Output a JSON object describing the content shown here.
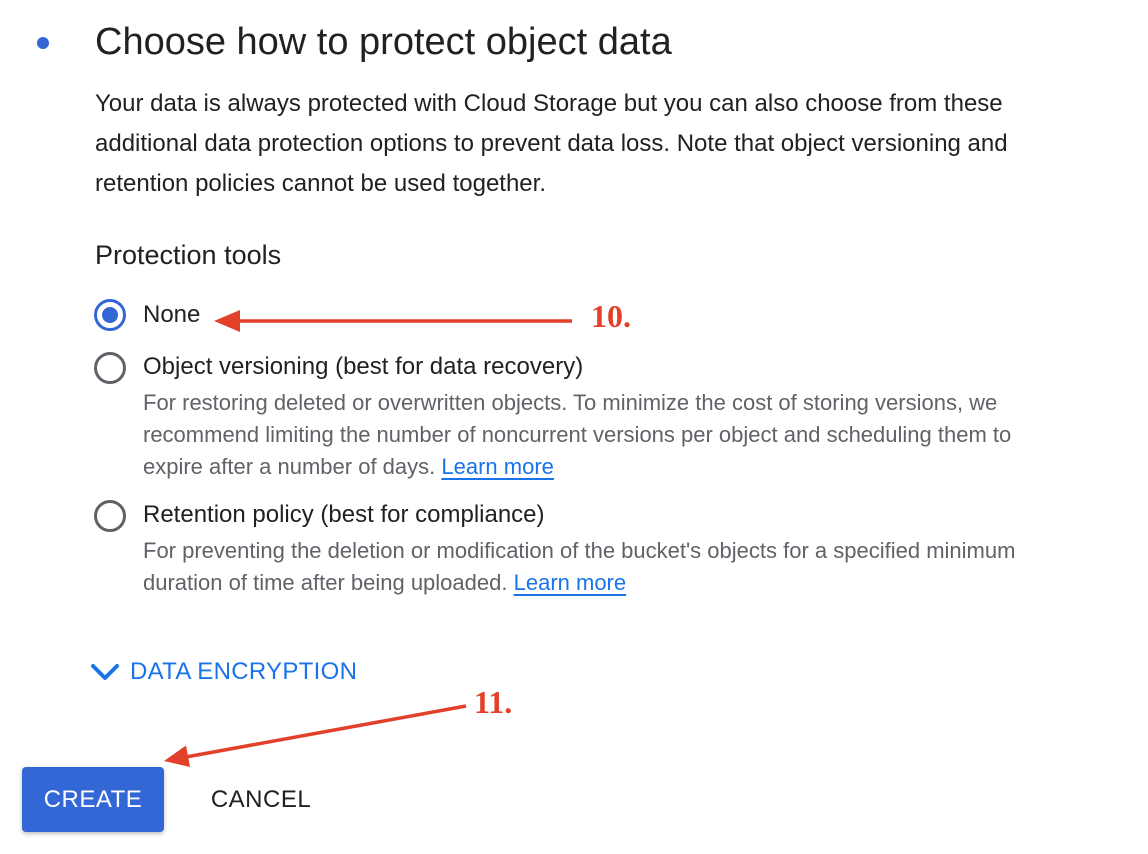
{
  "step": {
    "title": "Choose how to protect object data",
    "description": "Your data is always protected with Cloud Storage but you can also choose from these additional data protection options to prevent data loss. Note that object versioning and retention policies cannot be used together."
  },
  "protection_tools": {
    "heading": "Protection tools",
    "selected": "none",
    "options": [
      {
        "id": "none",
        "label": "None",
        "checked": true
      },
      {
        "id": "object-versioning",
        "label": "Object versioning (best for data recovery)",
        "checked": false,
        "description": "For restoring deleted or overwritten objects. To minimize the cost of storing versions, we recommend limiting the number of noncurrent versions per object and scheduling them to expire after a number of days.",
        "link": "Learn more"
      },
      {
        "id": "retention-policy",
        "label": "Retention policy (best for compliance)",
        "checked": false,
        "description": "For preventing the deletion or modification of the bucket's objects for a specified minimum duration of time after being uploaded.",
        "link": "Learn more"
      }
    ]
  },
  "data_encryption": {
    "label": "DATA ENCRYPTION",
    "icon": "chevron-down-icon",
    "expanded": false
  },
  "actions": {
    "create_label": "CREATE",
    "cancel_label": "CANCEL"
  },
  "annotations": {
    "step_10": "10.",
    "step_11": "11."
  },
  "colors": {
    "accent": "#3367d6",
    "link": "#1a73e8",
    "annotation": "#e2402b",
    "secondary_text": "#5f6368"
  }
}
